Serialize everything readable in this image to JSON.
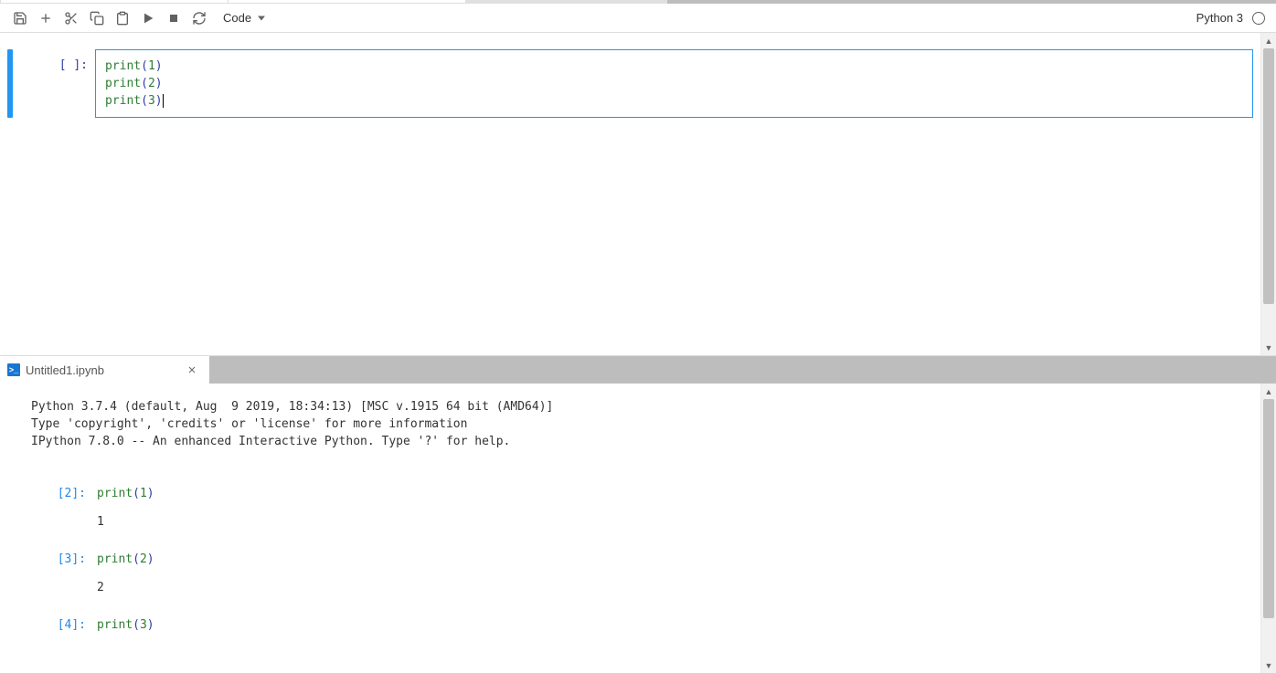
{
  "toolbar": {
    "celltype_selected": "Code"
  },
  "kernel": {
    "name": "Python 3"
  },
  "notebook": {
    "cell": {
      "prompt_open": "[",
      "prompt_mid": " ",
      "prompt_close": "]:",
      "lines": [
        {
          "fn": "print",
          "open": "(",
          "arg": "1",
          "close": ")"
        },
        {
          "fn": "print",
          "open": "(",
          "arg": "2",
          "close": ")"
        },
        {
          "fn": "print",
          "open": "(",
          "arg": "3",
          "close": ")"
        }
      ]
    }
  },
  "tab": {
    "label": "Untitled1.ipynb",
    "icon_glyph": ">_"
  },
  "console": {
    "header": "Python 3.7.4 (default, Aug  9 2019, 18:34:13) [MSC v.1915 64 bit (AMD64)]\nType 'copyright', 'credits' or 'license' for more information\nIPython 7.8.0 -- An enhanced Interactive Python. Type '?' for help.",
    "entries": [
      {
        "prompt": "[2]:",
        "in_fn": "print",
        "open": "(",
        "arg": "1",
        "close": ")",
        "out": "1"
      },
      {
        "prompt": "[3]:",
        "in_fn": "print",
        "open": "(",
        "arg": "2",
        "close": ")",
        "out": "2"
      },
      {
        "prompt": "[4]:",
        "in_fn": "print",
        "open": "(",
        "arg": "3",
        "close": ")",
        "out": ""
      }
    ]
  }
}
